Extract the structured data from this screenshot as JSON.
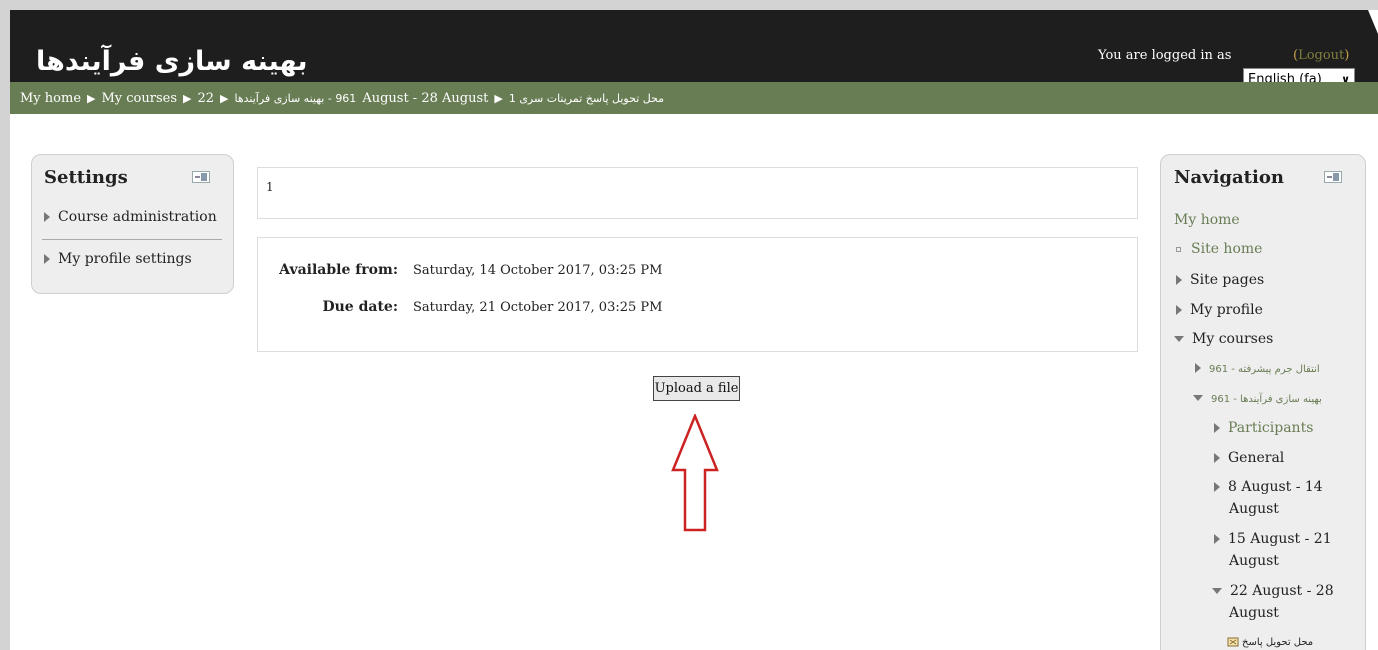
{
  "header": {
    "site_title": "بهینه سازی فرآیندها",
    "login_text": "You are logged in as",
    "logout_label": "Logout",
    "language": "English (fa)"
  },
  "breadcrumb": {
    "items": [
      "My home",
      "My courses",
      "22",
      "961 - بهینه سازی فرآیندها",
      "August - 28 August",
      "محل تحویل پاسخ تمرینات سری 1"
    ],
    "item4_prefix": "22 August - 28 August"
  },
  "settings": {
    "title": "Settings",
    "items": [
      "Course administration",
      "My profile settings"
    ]
  },
  "main": {
    "intro_text": "1",
    "available_label": "Available from:",
    "available_value": "Saturday, 14 October 2017, 03:25 PM",
    "due_label": "Due date:",
    "due_value": "Saturday, 21 October 2017, 03:25 PM",
    "upload_label": "Upload a file"
  },
  "navigation": {
    "title": "Navigation",
    "my_home": "My home",
    "site_home": "Site home",
    "site_pages": "Site pages",
    "my_profile": "My profile",
    "my_courses": "My courses",
    "course1": "انتقال جرم پیشرفته - 961",
    "course2": "بهینه سازی فرآیندها - 961",
    "participants": "Participants",
    "general": "General",
    "week1_line1": "8 August - 14",
    "week1_line2": "August",
    "week2_line1": "15 August - 21",
    "week2_line2": "August",
    "week3_line1": "22 August - 28",
    "week3_line2": "August",
    "assignment": "محل تحویل پاسخ"
  },
  "colors": {
    "header_bg": "#1e1e1e",
    "breadcrumb_bg": "#697d55",
    "link": "#697d55",
    "arrow": "#cc2222"
  }
}
